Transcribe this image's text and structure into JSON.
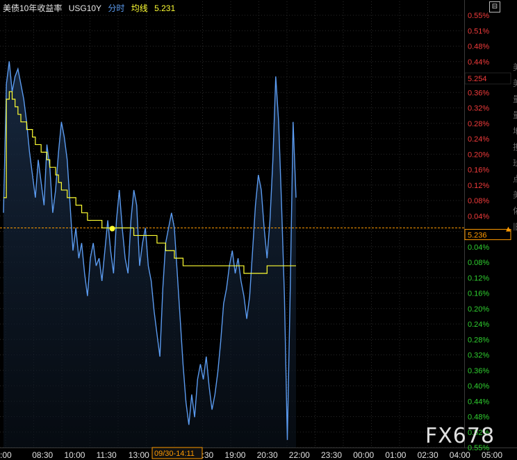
{
  "header": {
    "title": "美债10年收益率",
    "symbol": "USG10Y",
    "mode": "分时",
    "avg_label": "均线",
    "avg_value": "5.231"
  },
  "corner_button_glyph": "⊟",
  "watermark": "FX678",
  "colors": {
    "up": "#f33b3b",
    "down": "#2fd02f",
    "neutral": "#e8e8e8",
    "price_line": "#5b9bf0",
    "avg_line": "#ffff33",
    "grid": "#2a2a2a",
    "ref_line": "#ff9a00",
    "time_label": "#e0e0e0"
  },
  "chart_data": {
    "type": "line",
    "title": "美债10年收益率",
    "x_ticks": [
      ":00",
      "08:30",
      "10:00",
      "11:30",
      "13:00",
      "14",
      "17:30",
      "19:00",
      "20:30",
      "22:00",
      "23:30",
      "00:00",
      "01:00",
      "02:30",
      "04:00",
      "05:00"
    ],
    "crosshair_time": "09/30-14:11",
    "y_pct_ticks": [
      "0.55%",
      "0.51%",
      "0.48%",
      "0.44%",
      "0.40%",
      "0.36%",
      "0.32%",
      "0.28%",
      "0.24%",
      "0.20%",
      "0.16%",
      "0.12%",
      "0.08%",
      "0.04%",
      "0.00%",
      "0.04%",
      "0.08%",
      "0.12%",
      "0.16%",
      "0.20%",
      "0.24%",
      "0.28%",
      "0.32%",
      "0.36%",
      "0.40%",
      "0.44%",
      "0.48%",
      "0.52%",
      "0.55%"
    ],
    "reference_value": "5.236",
    "marker_value": "5.254",
    "ylim": [
      5.207,
      5.265
    ],
    "series": [
      {
        "name": "分时",
        "color": "#5b9bf0",
        "values": [
          5.238,
          5.255,
          5.258,
          5.254,
          5.256,
          5.257,
          5.255,
          5.253,
          5.25,
          5.246,
          5.243,
          5.24,
          5.245,
          5.242,
          5.239,
          5.247,
          5.244,
          5.238,
          5.241,
          5.246,
          5.25,
          5.248,
          5.245,
          5.239,
          5.233,
          5.236,
          5.232,
          5.234,
          5.23,
          5.227,
          5.232,
          5.234,
          5.231,
          5.232,
          5.229,
          5.233,
          5.237,
          5.233,
          5.23,
          5.237,
          5.241,
          5.236,
          5.232,
          5.23,
          5.237,
          5.241,
          5.239,
          5.231,
          5.234,
          5.236,
          5.231,
          5.229,
          5.225,
          5.222,
          5.219,
          5.228,
          5.234,
          5.236,
          5.238,
          5.236,
          5.23,
          5.224,
          5.218,
          5.213,
          5.21,
          5.214,
          5.211,
          5.216,
          5.218,
          5.216,
          5.219,
          5.215,
          5.212,
          5.214,
          5.217,
          5.221,
          5.226,
          5.228,
          5.231,
          5.233,
          5.23,
          5.232,
          5.229,
          5.227,
          5.224,
          5.227,
          5.233,
          5.239,
          5.243,
          5.241,
          5.236,
          5.232,
          5.237,
          5.245,
          5.256,
          5.25,
          5.239,
          5.227,
          5.208,
          5.228,
          5.25,
          5.24
        ],
        "width_minutes_note": ""
      },
      {
        "name": "均线",
        "color": "#ffff33",
        "values": [
          5.24,
          5.253,
          5.254,
          5.253,
          5.252,
          5.251,
          5.25,
          5.25,
          5.249,
          5.249,
          5.248,
          5.247,
          5.247,
          5.246,
          5.246,
          5.245,
          5.244,
          5.244,
          5.243,
          5.242,
          5.241,
          5.241,
          5.24,
          5.24,
          5.24,
          5.239,
          5.239,
          5.238,
          5.238,
          5.237,
          5.237,
          5.237,
          5.237,
          5.237,
          5.236,
          5.236,
          5.236,
          5.236,
          5.236,
          5.236,
          5.236,
          5.236,
          5.236,
          5.236,
          5.236,
          5.235,
          5.235,
          5.235,
          5.235,
          5.235,
          5.235,
          5.235,
          5.235,
          5.234,
          5.234,
          5.234,
          5.233,
          5.233,
          5.233,
          5.232,
          5.232,
          5.232,
          5.231,
          5.231,
          5.231,
          5.231,
          5.231,
          5.231,
          5.231,
          5.231,
          5.231,
          5.231,
          5.231,
          5.231,
          5.231,
          5.231,
          5.231,
          5.231,
          5.231,
          5.231,
          5.231,
          5.231,
          5.231,
          5.23,
          5.23,
          5.23,
          5.23,
          5.23,
          5.23,
          5.23,
          5.23,
          5.231,
          5.231,
          5.231,
          5.231,
          5.231,
          5.231,
          5.231,
          5.231,
          5.231,
          5.231,
          5.231
        ]
      }
    ],
    "highlight_point_index": 39
  },
  "right_strip_glyphs": [
    "美",
    "美",
    "量",
    "量",
    "地",
    "担",
    "班",
    "点",
    "美",
    "佑",
    "旧"
  ]
}
